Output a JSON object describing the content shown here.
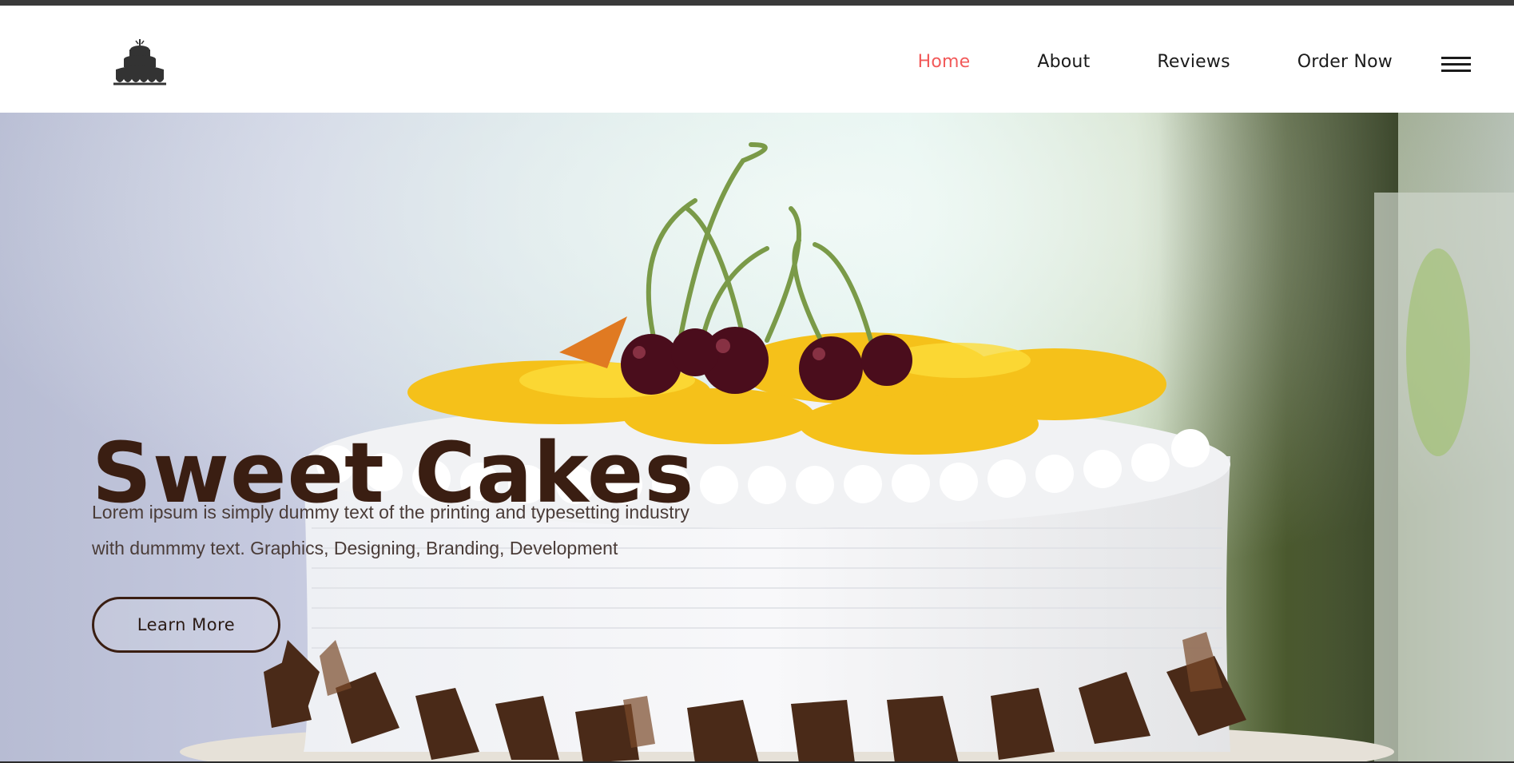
{
  "header": {
    "logo_icon": "cake-logo-icon",
    "nav": [
      {
        "label": "Home",
        "active": true
      },
      {
        "label": "About",
        "active": false
      },
      {
        "label": "Reviews",
        "active": false
      },
      {
        "label": "Order Now",
        "active": false
      }
    ],
    "menu_icon": "hamburger-menu-icon"
  },
  "hero": {
    "title": "Sweet Cakes",
    "description_line1": "Lorem ipsum is simply dummy text of the printing and typesetting industry",
    "description_line2": "with dummmy text. Graphics, Designing, Branding, Development",
    "button_label": "Learn More"
  },
  "colors": {
    "nav_active": "#f25a5a",
    "nav_default": "#1b1b1b",
    "title": "#3a1e12",
    "button_border": "#3a1e12"
  }
}
